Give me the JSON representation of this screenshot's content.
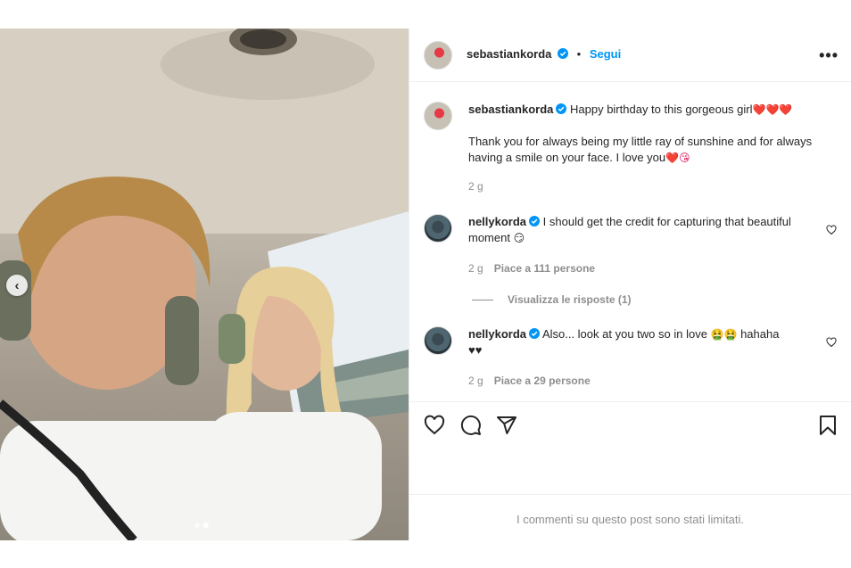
{
  "post": {
    "author": "sebastiankorda",
    "follow_separator": "•",
    "follow_label": "Segui",
    "more_label": "•••",
    "verified": true
  },
  "media": {
    "description_icon": "photo-carousel",
    "nav_prev_glyph": "‹",
    "carousel_dots": 2,
    "active_dot": 2
  },
  "caption": {
    "username": "sebastiankorda",
    "line1": "Happy birthday to this gorgeous girl",
    "line1_emojis": "❤️❤️❤️",
    "line2": "Thank you for always being my little ray of sunshine and for always having a smile on your face. I love you",
    "line2_emojis": "❤️😘",
    "time": "2 g"
  },
  "comments": [
    {
      "username": "nellykorda",
      "text": "I should get the credit for capturing that beautiful moment",
      "emoji": "😏",
      "time": "2 g",
      "likes": "Piace a 111 persone"
    },
    {
      "username": "nellykorda",
      "text": "Also... look at you two so in love",
      "emoji": "🤮🤮",
      "text_after": "hahaha",
      "text_line2": "♥♥",
      "time": "2 g",
      "likes": "Piace a 29 persone"
    }
  ],
  "replies_label": "Visualizza le risposte (1)",
  "actions": {
    "icons": [
      "heart-icon",
      "comment-icon",
      "share-icon",
      "bookmark-icon"
    ]
  },
  "comments_limited_text": "I commenti su questo post sono stati limitati.",
  "colors": {
    "accent": "#0095f6",
    "text": "#262626",
    "muted": "#8e8e8e",
    "verified": "#0095f6",
    "heart": "#e0245e"
  }
}
